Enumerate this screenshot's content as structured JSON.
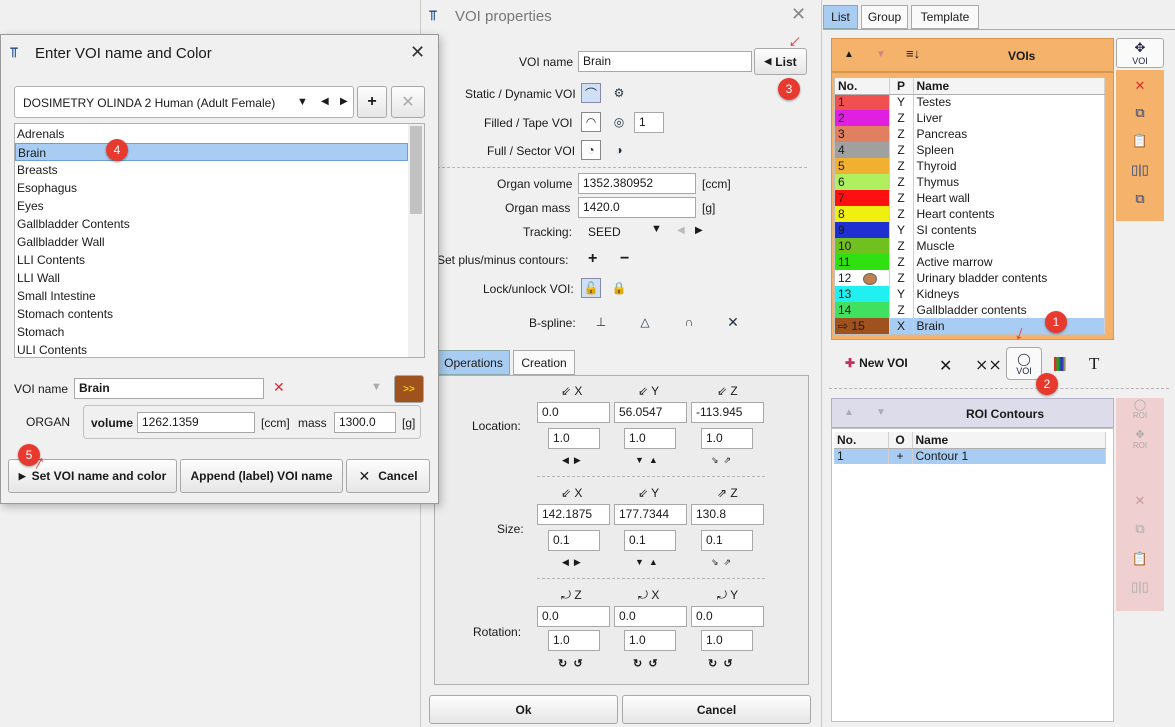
{
  "voi_props": {
    "title": "VOI properties",
    "voi_name_label": "VOI name",
    "voi_name": "Brain",
    "list_button": "List",
    "static_dynamic": "Static / Dynamic VOI",
    "filled_tape": "Filled / Tape VOI",
    "tape_value": "1",
    "full_sector": "Full / Sector VOI",
    "organ_volume_label": "Organ volume",
    "organ_volume": "1352.380952",
    "organ_volume_unit": "[ccm]",
    "organ_mass_label": "Organ mass",
    "organ_mass": "1420.0",
    "organ_mass_unit": "[g]",
    "tracking_label": "Tracking:",
    "tracking_value": "SEED",
    "plusminus_label": "Set plus/minus contours:",
    "lock_label": "Lock/unlock VOI:",
    "bspline_label": "B-spline:",
    "tabs": [
      "Operations",
      "Creation"
    ],
    "location_label": "Location:",
    "loc": {
      "x": "0.0",
      "y": "56.0547",
      "z": "-113.945",
      "sx": "1.0",
      "sy": "1.0",
      "sz": "1.0"
    },
    "size_label": "Size:",
    "size": {
      "x": "142.1875",
      "y": "177.7344",
      "z": "130.8",
      "sx": "0.1",
      "sy": "0.1",
      "sz": "0.1"
    },
    "rotation_label": "Rotation:",
    "rot": {
      "z": "0.0",
      "x": "0.0",
      "y": "0.0",
      "sz": "1.0",
      "sx": "1.0",
      "sy": "1.0"
    },
    "axis": {
      "x": "X",
      "y": "Y",
      "z": "Z"
    },
    "ok": "Ok",
    "cancel": "Cancel"
  },
  "dialog": {
    "title": "Enter VOI name and Color",
    "template": "DOSIMETRY OLINDA 2 Human (Adult Female)",
    "organs": [
      "Adrenals",
      "Brain",
      "Breasts",
      "Esophagus",
      "Eyes",
      "Gallbladder Contents",
      "Gallbladder Wall",
      "LLI Contents",
      "LLI Wall",
      "Small Intestine",
      "Stomach contents",
      "Stomach",
      "ULI Contents"
    ],
    "voi_name_label": "VOI name",
    "voi_name": "Brain",
    "organ_label": "ORGAN",
    "volume_label": "volume",
    "volume": "1262.1359",
    "volume_unit": "[ccm]",
    "mass_label": "mass",
    "mass": "1300.0",
    "mass_unit": "[g]",
    "set_button": "Set VOI name and color",
    "append_button": "Append (label) VOI name",
    "cancel_button": "Cancel",
    "more_button": ">>",
    "color_swatch": "#a0521e"
  },
  "right": {
    "tabs": [
      "List",
      "Group",
      "Template"
    ],
    "vois_title": "VOIs",
    "cols": [
      "No.",
      "P",
      "Name"
    ],
    "rows": [
      {
        "no": "1",
        "p": "Y",
        "name": "Testes",
        "color": "#f05050"
      },
      {
        "no": "2",
        "p": "Z",
        "name": "Liver",
        "color": "#e020e0"
      },
      {
        "no": "3",
        "p": "Z",
        "name": "Pancreas",
        "color": "#e08060"
      },
      {
        "no": "4",
        "p": "Z",
        "name": "Spleen",
        "color": "#a0a0a0"
      },
      {
        "no": "5",
        "p": "Z",
        "name": "Thyroid",
        "color": "#f0b030"
      },
      {
        "no": "6",
        "p": "Z",
        "name": "Thymus",
        "color": "#b0f060"
      },
      {
        "no": "7",
        "p": "Z",
        "name": "Heart wall",
        "color": "#ff1010"
      },
      {
        "no": "8",
        "p": "Z",
        "name": "Heart contents",
        "color": "#f0f010"
      },
      {
        "no": "9",
        "p": "Y",
        "name": "SI contents",
        "color": "#2030d0"
      },
      {
        "no": "10",
        "p": "Z",
        "name": "Muscle",
        "color": "#70c020"
      },
      {
        "no": "11",
        "p": "Z",
        "name": "Active marrow",
        "color": "#30e010"
      },
      {
        "no": "12",
        "p": "Z",
        "name": "Urinary bladder contents",
        "color": "#b0f0a0"
      },
      {
        "no": "13",
        "p": "Y",
        "name": "Kidneys",
        "color": "#20f0f0"
      },
      {
        "no": "14",
        "p": "Z",
        "name": "Gallbladder contents",
        "color": "#40e060"
      },
      {
        "no": "15",
        "p": "X",
        "name": "Brain",
        "color": "#a0521e"
      }
    ],
    "new_voi": "New VOI",
    "voi_btn": "VOI",
    "roi_title": "ROI Contours",
    "roi_cols": [
      "No.",
      "O",
      "Name"
    ],
    "roi_rows": [
      {
        "no": "1",
        "o": "+",
        "name": "Contour 1"
      }
    ],
    "roi_lbl": "ROI"
  },
  "badges": [
    "1",
    "2",
    "3",
    "4",
    "5"
  ]
}
